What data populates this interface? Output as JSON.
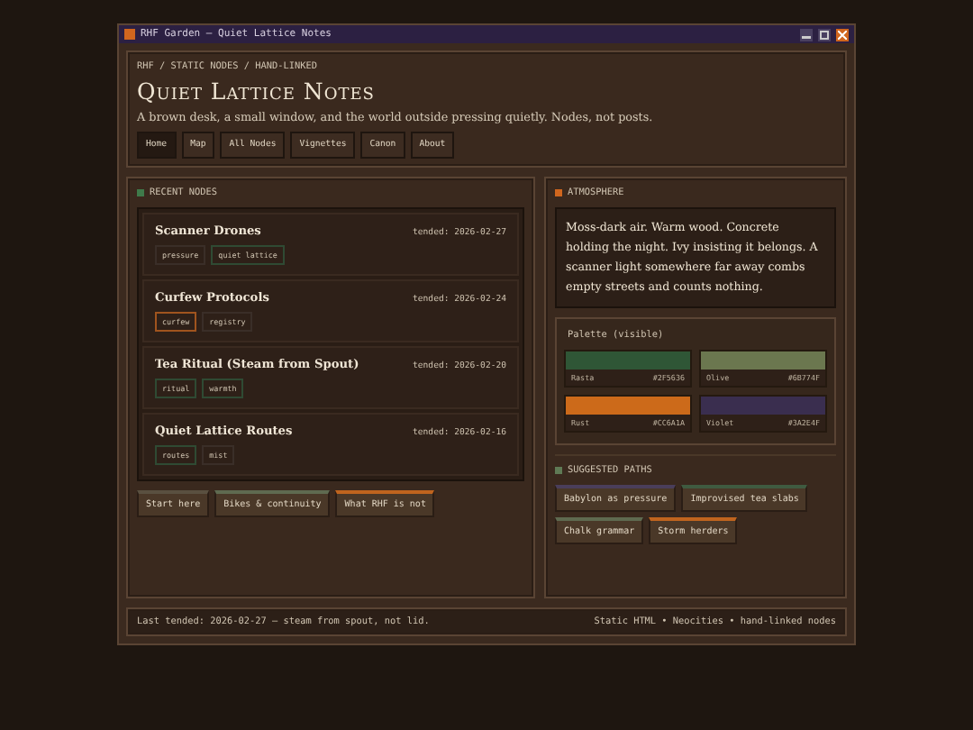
{
  "window": {
    "title": "RHF Garden — Quiet Lattice Notes"
  },
  "header": {
    "breadcrumb": "RHF / STATIC NODES / HAND-LINKED",
    "title": "Quiet Lattice Notes",
    "tagline": "A brown desk, a small window, and the world outside pressing quietly. Nodes, not posts.",
    "tabs": [
      {
        "label": "Home",
        "selected": true
      },
      {
        "label": "Map",
        "selected": false
      },
      {
        "label": "All Nodes",
        "selected": false
      },
      {
        "label": "Vignettes",
        "selected": false
      },
      {
        "label": "Canon",
        "selected": false
      },
      {
        "label": "About",
        "selected": false
      }
    ]
  },
  "recent": {
    "heading": "RECENT NODES",
    "color": "#3f7a4a",
    "nodes": [
      {
        "title": "Scanner Drones",
        "date": "tended: 2026-02-27",
        "tags": [
          {
            "label": "pressure",
            "color": "#3a2e28"
          },
          {
            "label": "quiet lattice",
            "color": "#2f4a33"
          }
        ]
      },
      {
        "title": "Curfew Protocols",
        "date": "tended: 2026-02-24",
        "tags": [
          {
            "label": "curfew",
            "color": "#a0541e"
          },
          {
            "label": "registry",
            "color": "#3a2e28"
          }
        ]
      },
      {
        "title": "Tea Ritual (Steam from Spout)",
        "date": "tended: 2026-02-20",
        "tags": [
          {
            "label": "ritual",
            "color": "#2f4a33"
          },
          {
            "label": "warmth",
            "color": "#2f4a33"
          }
        ]
      },
      {
        "title": "Quiet Lattice Routes",
        "date": "tended: 2026-02-16",
        "tags": [
          {
            "label": "routes",
            "color": "#2f4a33"
          },
          {
            "label": "mist",
            "color": "#3a2e28"
          }
        ]
      }
    ],
    "links": [
      {
        "label": "Start here",
        "color": "#5a5040"
      },
      {
        "label": "Bikes & continuity",
        "color": "#5f6a50"
      },
      {
        "label": "What RHF is not",
        "color": "#c0641e"
      }
    ]
  },
  "atmosphere": {
    "heading": "ATMOSPHERE",
    "color": "#d0661e",
    "text": "Moss-dark air. Warm wood. Concrete holding the night. Ivy insisting it belongs. A scanner light somewhere far away combs empty streets and counts nothing.",
    "palette": {
      "title": "Palette (visible)",
      "swatches": [
        {
          "name": "Rasta",
          "hex": "#2F5636",
          "color": "#2f5636"
        },
        {
          "name": "Olive",
          "hex": "#6B774F",
          "color": "#6b774f"
        },
        {
          "name": "Rust",
          "hex": "#CC6A1A",
          "color": "#cc6a1a"
        },
        {
          "name": "Violet",
          "hex": "#3A2E4F",
          "color": "#3a2e4f"
        }
      ]
    }
  },
  "paths": {
    "heading": "SUGGESTED PATHS",
    "color": "#5f7a55",
    "links": [
      {
        "label": "Babylon as pressure",
        "color": "#4a3e5a"
      },
      {
        "label": "Improvised tea slabs",
        "color": "#3f5a40"
      },
      {
        "label": "Chalk grammar",
        "color": "#5f6a50"
      },
      {
        "label": "Storm herders",
        "color": "#c0641e"
      }
    ]
  },
  "status_bar": {
    "left": "Last tended: 2026-02-27 — steam from spout, not lid.",
    "right": "Static HTML • Neocities • hand-linked nodes"
  }
}
